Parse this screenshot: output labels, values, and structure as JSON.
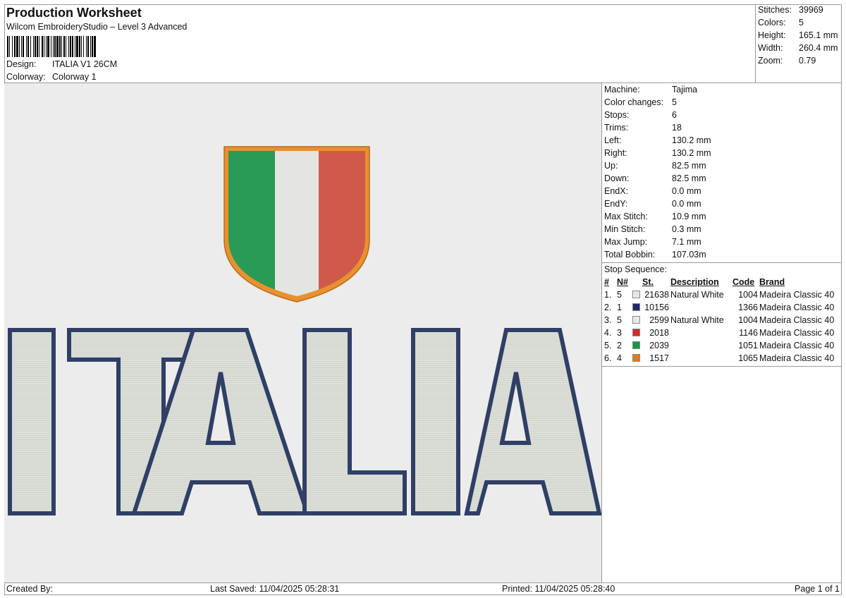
{
  "header": {
    "title": "Production Worksheet",
    "subtitle": "Wilcom EmbroideryStudio – Level 3 Advanced",
    "design_label": "Design:",
    "design_value": "ITALIA V1 26CM",
    "colorway_label": "Colorway:",
    "colorway_value": "Colorway 1"
  },
  "summary": [
    {
      "label": "Stitches:",
      "value": "39969"
    },
    {
      "label": "Colors:",
      "value": "5"
    },
    {
      "label": "Height:",
      "value": "165.1 mm"
    },
    {
      "label": "Width:",
      "value": "260.4 mm"
    },
    {
      "label": "Zoom:",
      "value": "0.79"
    }
  ],
  "machine_info": [
    {
      "label": "Machine:",
      "value": "Tajima"
    },
    {
      "label": "Color changes:",
      "value": "5"
    },
    {
      "label": "Stops:",
      "value": "6"
    },
    {
      "label": "Trims:",
      "value": "18"
    },
    {
      "label": "Left:",
      "value": "130.2 mm"
    },
    {
      "label": "Right:",
      "value": "130.2 mm"
    },
    {
      "label": "Up:",
      "value": "82.5 mm"
    },
    {
      "label": "Down:",
      "value": "82.5 mm"
    },
    {
      "label": "EndX:",
      "value": "0.0 mm"
    },
    {
      "label": "EndY:",
      "value": "0.0 mm"
    },
    {
      "label": "Max Stitch:",
      "value": "10.9 mm"
    },
    {
      "label": "Min Stitch:",
      "value": "0.3 mm"
    },
    {
      "label": "Max Jump:",
      "value": "7.1 mm"
    },
    {
      "label": "Total Bobbin:",
      "value": "107.03m"
    }
  ],
  "stop_sequence": {
    "title": "Stop Sequence:",
    "headers": [
      "#",
      "N#",
      "St.",
      "Description",
      "Code",
      "Brand"
    ],
    "rows": [
      {
        "idx": "1.",
        "n": "5",
        "color": "#e8e8e8",
        "st": "21638",
        "desc": "Natural White",
        "code": "1004",
        "brand": "Madeira Classic 40"
      },
      {
        "idx": "2.",
        "n": "1",
        "color": "#1f2a6b",
        "st": "10156",
        "desc": "",
        "code": "1366",
        "brand": "Madeira Classic 40"
      },
      {
        "idx": "3.",
        "n": "5",
        "color": "#e8e8e8",
        "st": "2599",
        "desc": "Natural White",
        "code": "1004",
        "brand": "Madeira Classic 40"
      },
      {
        "idx": "4.",
        "n": "3",
        "color": "#d42a2a",
        "st": "2018",
        "desc": "",
        "code": "1146",
        "brand": "Madeira Classic 40"
      },
      {
        "idx": "5.",
        "n": "2",
        "color": "#129a48",
        "st": "2039",
        "desc": "",
        "code": "1051",
        "brand": "Madeira Classic 40"
      },
      {
        "idx": "6.",
        "n": "4",
        "color": "#e07b20",
        "st": "1517",
        "desc": "",
        "code": "1065",
        "brand": "Madeira Classic 40"
      }
    ]
  },
  "design_text": "ITALIA",
  "colors": {
    "shield_border": "#e8912e",
    "flag_green": "#2a9a57",
    "flag_white": "#e4e4e0",
    "flag_red": "#cf5a4c",
    "letter_outline": "#2f3f66",
    "letter_fill": "#dcdfd8",
    "canvas_bg": "#ececec"
  },
  "footer": {
    "created_by": "Created By:",
    "last_saved": "Last Saved: 11/04/2025 05:28:31",
    "printed": "Printed: 11/04/2025 05:28:40",
    "page": "Page 1 of 1"
  }
}
